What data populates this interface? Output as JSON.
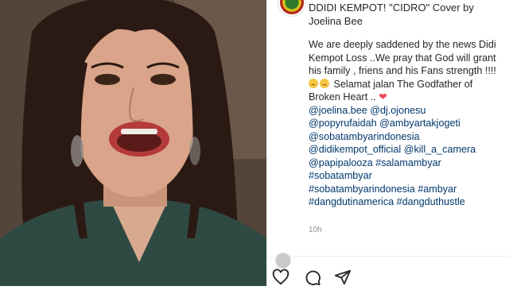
{
  "post": {
    "username": "",
    "title_line": "DDIDI KEMPOT! \"CIDRO\" Cover by Joelina Bee",
    "caption_main": "We are deeply saddened by the news Didi Kempot Loss ..We pray that God will grant his family , friens and his Fans strength !!!! ",
    "caption_tail": " Selamat jalan The Godfather of Broken Heart .. ",
    "emoji": [
      "sad-face-emoji",
      "sad-face-emoji"
    ],
    "heart": "❤",
    "tags": [
      "@joelina.bee",
      "@dj.ojonesu",
      "@popyrufaidah",
      "@ambyartakjogeti",
      "@sobatambyarindonesia",
      "@didikempot_official",
      "@kill_a_camera",
      "@papipalooza",
      "#salamambyar",
      "#sobatambyar",
      "#sobatambyarindonesia",
      "#ambyar",
      "#dangdutinamerica",
      "#dangduthustle"
    ],
    "timestamp": "10h"
  },
  "actions": {
    "like_icon": "heart-outline-icon",
    "comment_icon": "comment-bubble-icon",
    "share_icon": "paper-plane-icon"
  },
  "colors": {
    "text": "#262626",
    "link": "#00376b",
    "muted": "#8e8e8e",
    "heart": "#ed4956"
  }
}
